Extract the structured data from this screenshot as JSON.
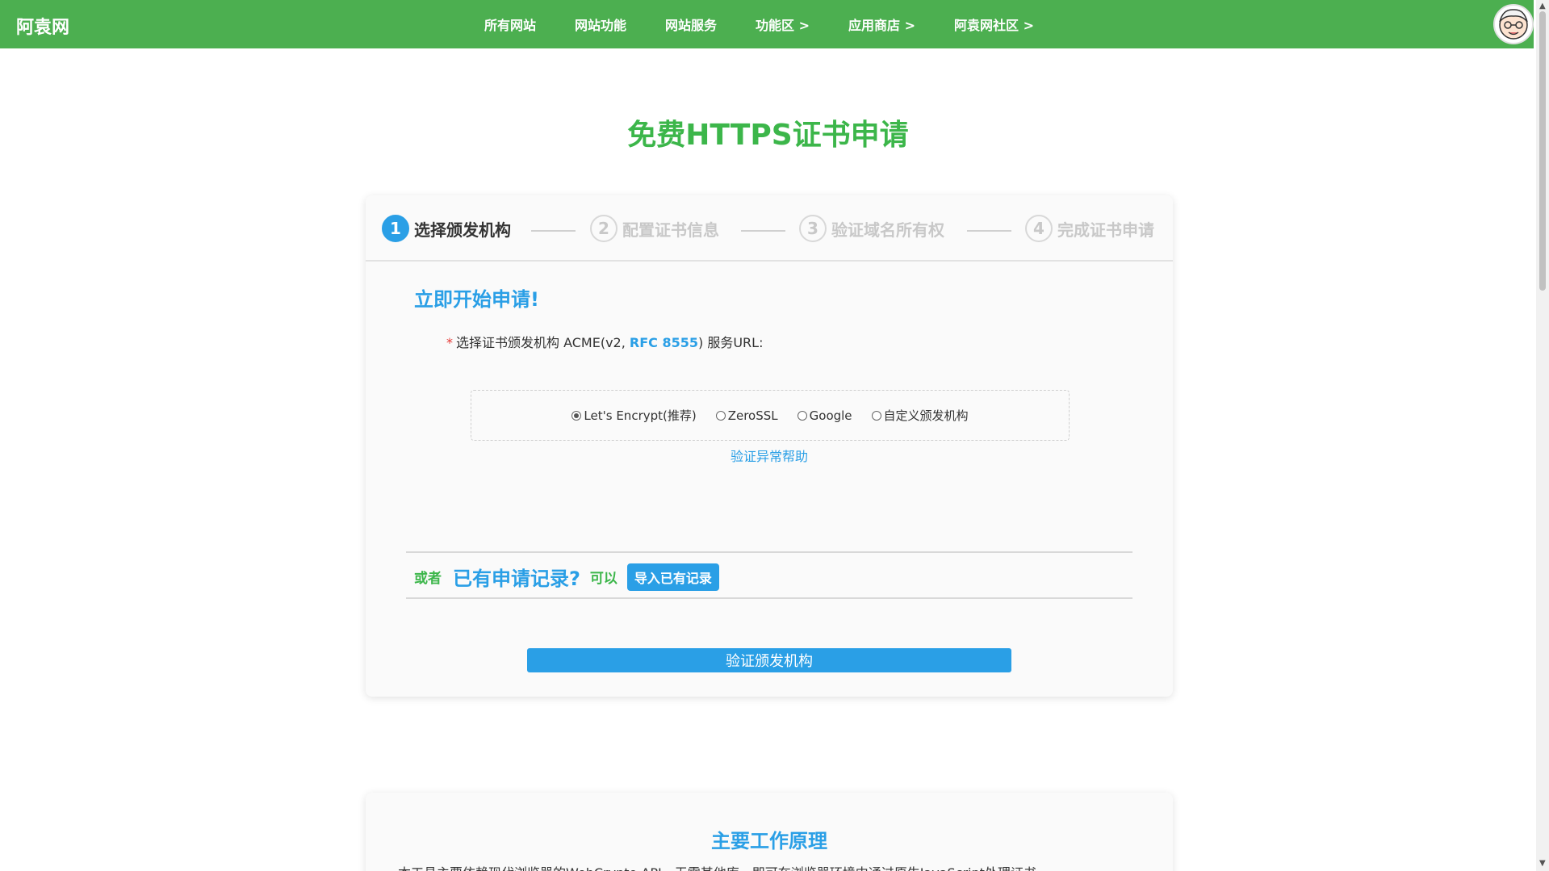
{
  "header": {
    "brand": "阿袁网",
    "nav": [
      "所有网站",
      "网站功能",
      "网站服务",
      "功能区 >",
      "应用商店 >",
      "阿袁网社区 >"
    ]
  },
  "page_title": "免费HTTPS证书申请",
  "steps": [
    {
      "num": "1",
      "label": "选择颁发机构"
    },
    {
      "num": "2",
      "label": "配置证书信息"
    },
    {
      "num": "3",
      "label": "验证域名所有权"
    },
    {
      "num": "4",
      "label": "完成证书申请"
    }
  ],
  "form": {
    "section_title": "立即开始申请!",
    "required_mark": "*",
    "field_label_prefix": "选择证书颁发机构 ACME(v2, ",
    "field_label_rfc": "RFC 8555",
    "field_label_suffix": ") 服务URL:",
    "options": [
      "Let's Encrypt(推荐)",
      "ZeroSSL",
      "Google",
      "自定义颁发机构"
    ],
    "help_link": "验证异常帮助",
    "or_text": "或者",
    "record_question": "已有申请记录?",
    "can_text": "可以",
    "import_button": "导入已有记录",
    "verify_button": "验证颁发机构"
  },
  "principle": {
    "title": "主要工作原理",
    "text": "本工具主要依赖现代浏览器的WebCrypto API，无需其他库，即可在浏览器环境中通过原生JavaScript处理证书"
  },
  "colors": {
    "header_bg": "#4caf50",
    "title_green": "#3cb64a",
    "accent_blue": "#2a9fe6"
  }
}
